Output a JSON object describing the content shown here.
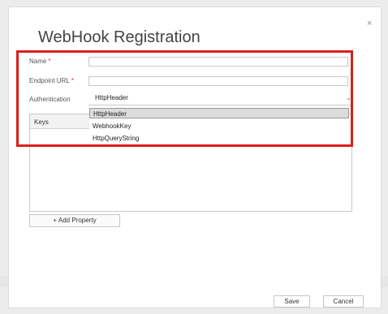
{
  "dialog": {
    "title": "WebHook Registration",
    "close_label": "×"
  },
  "form": {
    "name_label": "Name",
    "name_value": "",
    "endpoint_label": "Endpoint URL",
    "endpoint_value": "",
    "required_mark": "*",
    "auth_label": "Authentication",
    "auth_selected": "HttpHeader",
    "auth_options": [
      "HttpHeader",
      "WebhookKey",
      "HttpQueryString"
    ]
  },
  "properties": {
    "keys_header": "Keys",
    "add_button": "+ Add Property"
  },
  "footer": {
    "save_label": "Save",
    "cancel_label": "Cancel"
  },
  "colors": {
    "highlight": "#d9201d",
    "required": "#d0312d"
  },
  "icons": {
    "close": "close-icon",
    "dropdown": "chevron-down-icon"
  }
}
